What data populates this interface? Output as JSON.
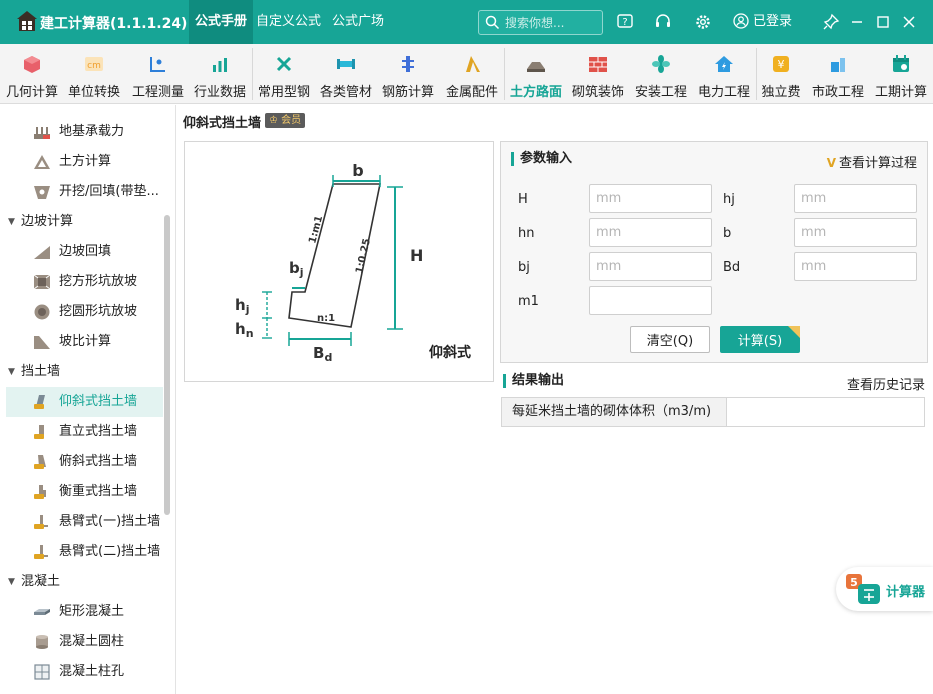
{
  "app": {
    "title": "建工计算器(1.1.1.24)"
  },
  "nav": {
    "tabs": [
      "公式手册",
      "自定义公式",
      "公式广场"
    ]
  },
  "search": {
    "placeholder": "搜索你想..."
  },
  "user": {
    "login_label": "已登录"
  },
  "toolbar": {
    "items": [
      {
        "label": "几何计算",
        "icon": "cube-icon",
        "color": "#e8606a"
      },
      {
        "label": "单位转换",
        "icon": "unit-cm-icon",
        "color": "#f0a030"
      },
      {
        "label": "工程测量",
        "icon": "measure-icon",
        "color": "#2e7fd9"
      },
      {
        "label": "行业数据",
        "icon": "bar-chart-icon",
        "color": "#17a596"
      },
      {
        "label": "常用型钢",
        "icon": "tools-icon",
        "color": "#17a596"
      },
      {
        "label": "各类管材",
        "icon": "pipe-icon",
        "color": "#2ab8d8"
      },
      {
        "label": "钢筋计算",
        "icon": "rebar-icon",
        "color": "#3f6fd8"
      },
      {
        "label": "金属配件",
        "icon": "hook-icon",
        "color": "#e0a422"
      },
      {
        "label": "土方路面",
        "icon": "road-icon",
        "color": "#8a7e72"
      },
      {
        "label": "砌筑装饰",
        "icon": "brick-icon",
        "color": "#e0524a"
      },
      {
        "label": "安装工程",
        "icon": "fan-icon",
        "color": "#17a596"
      },
      {
        "label": "电力工程",
        "icon": "house-power-icon",
        "color": "#2e9be0"
      },
      {
        "label": "独立费",
        "icon": "fee-icon",
        "color": "#f0b020"
      },
      {
        "label": "市政工程",
        "icon": "municipal-icon",
        "color": "#2e9be0"
      },
      {
        "label": "工期计算",
        "icon": "calendar-icon",
        "color": "#17a596"
      }
    ]
  },
  "sidebar": {
    "items": [
      {
        "label": "地基承载力",
        "type": "item",
        "icon": "foundation-icon"
      },
      {
        "label": "土方计算",
        "type": "item",
        "icon": "earthwork-icon"
      },
      {
        "label": "开挖/回填(带垫...",
        "type": "item",
        "icon": "excavation-icon"
      },
      {
        "label": "边坡计算",
        "type": "category"
      },
      {
        "label": "边坡回填",
        "type": "item",
        "icon": "slope-fill-icon"
      },
      {
        "label": "挖方形坑放坡",
        "type": "item",
        "icon": "square-pit-icon"
      },
      {
        "label": "挖圆形坑放坡",
        "type": "item",
        "icon": "round-pit-icon"
      },
      {
        "label": "坡比计算",
        "type": "item",
        "icon": "slope-ratio-icon"
      },
      {
        "label": "挡土墙",
        "type": "category"
      },
      {
        "label": "仰斜式挡土墙",
        "type": "item",
        "icon": "wall-vip-icon",
        "selected": true
      },
      {
        "label": "直立式挡土墙",
        "type": "item",
        "icon": "wall-vip-icon"
      },
      {
        "label": "俯斜式挡土墙",
        "type": "item",
        "icon": "wall-vip-icon"
      },
      {
        "label": "衡重式挡土墙",
        "type": "item",
        "icon": "wall-vip-icon"
      },
      {
        "label": "悬臂式(一)挡土墙",
        "type": "item",
        "icon": "wall-vip-icon"
      },
      {
        "label": "悬臂式(二)挡土墙",
        "type": "item",
        "icon": "wall-vip-icon"
      },
      {
        "label": "混凝土",
        "type": "category"
      },
      {
        "label": "矩形混凝土",
        "type": "item",
        "icon": "rect-concrete-icon"
      },
      {
        "label": "混凝土圆柱",
        "type": "item",
        "icon": "cylinder-icon"
      },
      {
        "label": "混凝土柱孔",
        "type": "item",
        "icon": "column-hole-icon"
      }
    ]
  },
  "page": {
    "title": "仰斜式挡土墙",
    "badge": "会员"
  },
  "diagram": {
    "labels": {
      "b": "b",
      "H": "H",
      "hj": "hj",
      "hn": "hn",
      "Bd": "Bd",
      "slope1": "1:m1",
      "slope2": "1:0.25",
      "ratio": "n:1",
      "style": "仰斜式"
    }
  },
  "params": {
    "title": "参数输入",
    "view_process": "查看计算过程",
    "vip_mark": "V",
    "fields": [
      {
        "label": "H",
        "placeholder": "mm",
        "value": ""
      },
      {
        "label": "hj",
        "placeholder": "mm",
        "value": ""
      },
      {
        "label": "hn",
        "placeholder": "mm",
        "value": ""
      },
      {
        "label": "b",
        "placeholder": "mm",
        "value": ""
      },
      {
        "label": "bj",
        "placeholder": "mm",
        "value": ""
      },
      {
        "label": "Bd",
        "placeholder": "mm",
        "value": ""
      },
      {
        "label": "m1",
        "placeholder": "",
        "value": ""
      }
    ],
    "clear_label": "清空(Q)",
    "calc_label": "计算(S)"
  },
  "result": {
    "title": "结果输出",
    "history_label": "查看历史记录",
    "rows": [
      {
        "label": "每延米挡土墙的砌体体积（m3/m)",
        "value": ""
      }
    ]
  },
  "float_button": {
    "label": "计算器"
  },
  "colors": {
    "brand": "#17a596",
    "brand_dark": "#0f8c7f",
    "vip": "#e0a422"
  }
}
